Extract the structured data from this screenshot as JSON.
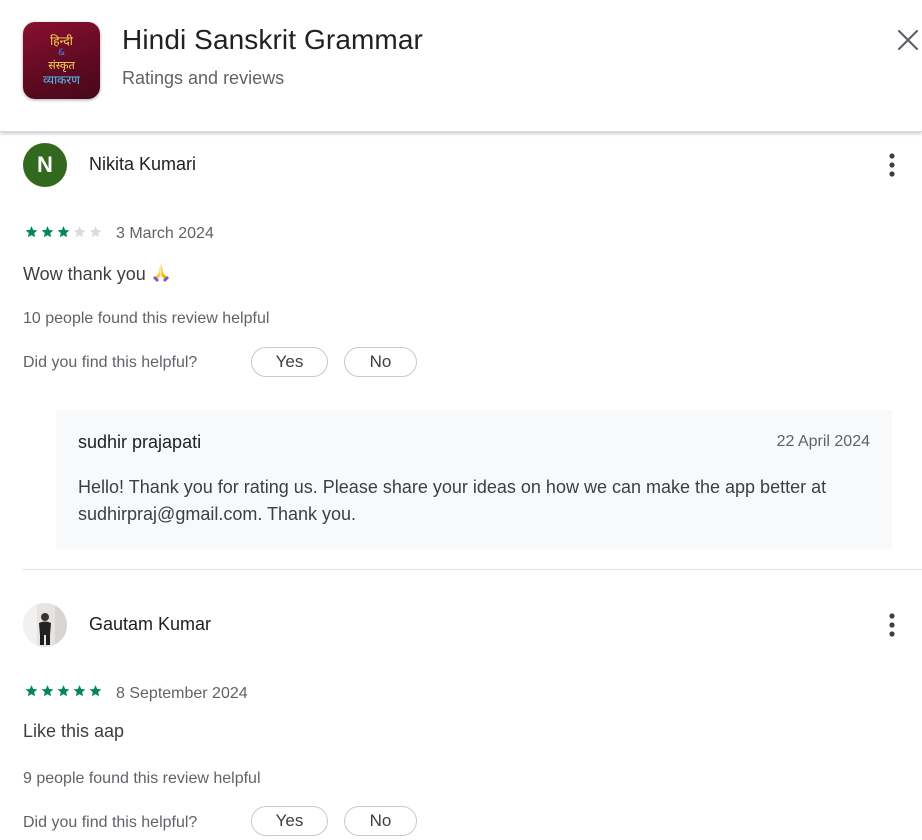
{
  "app": {
    "title": "Hindi Sanskrit Grammar",
    "subtitle": "Ratings and reviews",
    "icon_lines": [
      "हिन्दी",
      "&",
      "संस्कृत",
      "व्याकरण"
    ]
  },
  "colors": {
    "star_filled": "#01875f",
    "star_empty": "#dadce0",
    "avatar_n": "#33691e",
    "reply_bg": "#f8f9fa"
  },
  "reviews": [
    {
      "name": "Nikita Kumari",
      "avatar_letter": "N",
      "rating": 3,
      "date": "3 March 2024",
      "text": "Wow thank you",
      "text_emoji": "folded-hands-emoji",
      "helpful_count": "10 people found this review helpful",
      "helpful_question": "Did you find this helpful?",
      "yes_label": "Yes",
      "no_label": "No",
      "reply": {
        "author": "sudhir prajapati",
        "date": "22 April 2024",
        "text": "Hello! Thank you for rating us. Please share your ideas on how we can make the app better at sudhirpraj@gmail.com. Thank you."
      }
    },
    {
      "name": "Gautam Kumar",
      "avatar_icon": "user-photo-avatar",
      "rating": 5,
      "date": "8 September 2024",
      "text": "Like this aap",
      "helpful_count": "9 people found this review helpful",
      "helpful_question": "Did you find this helpful?",
      "yes_label": "Yes",
      "no_label": "No"
    }
  ]
}
